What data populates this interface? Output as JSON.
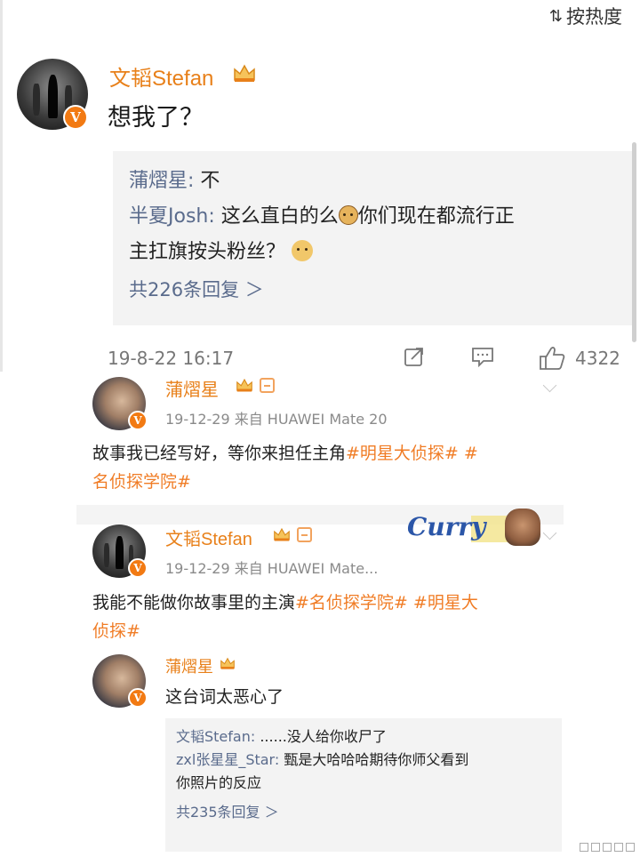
{
  "top": {
    "sort_label": "按热度",
    "comment": {
      "username": "文韬Stefan",
      "text": "想我了？",
      "replies": [
        {
          "user": "蒲熠星:",
          "text": "不"
        },
        {
          "user": "半夏Josh:",
          "text_before": "这么直白的么",
          "text_after": "你们现在都流行正",
          "text_line2": "主扛旗按头粉丝？"
        }
      ],
      "more_replies": "共226条回复 ＞",
      "time": "19-8-22 16:17",
      "likes": "4322"
    }
  },
  "bottom": {
    "post1": {
      "username": "蒲熠星",
      "meta": "19-12-29  来自 HUAWEI Mate 20",
      "text_before": "故事我已经写好，等你来担任主角",
      "tag1": "#明星大侦探#",
      "tag2": "#",
      "tag2_line2": "名侦探学院#"
    },
    "post2": {
      "username": "文韬Stefan",
      "meta": "19-12-29  来自 HUAWEI Mate...",
      "text_before": "我能不能做你故事里的主演",
      "tag1": "#名侦探学院#",
      "tag2_part1": "#明星大",
      "tag2_part2": "侦探#",
      "overlay_word": "Curry"
    },
    "reply": {
      "username": "蒲熠星",
      "text": "这台词太恶心了",
      "sub_replies": [
        {
          "user": "文韬Stefan:",
          "text": "......没人给你收尸了"
        },
        {
          "user": "zxl张星星_Star:",
          "text": "甄是大哈哈哈期待你师父看到",
          "text_line2": "你照片的反应"
        }
      ],
      "more": "共235条回复 ＞"
    }
  },
  "colors": {
    "username": "#e8801a",
    "hashtag": "#f07c25",
    "reply_user": "#5a6b8c",
    "verified": "#f27a13"
  }
}
